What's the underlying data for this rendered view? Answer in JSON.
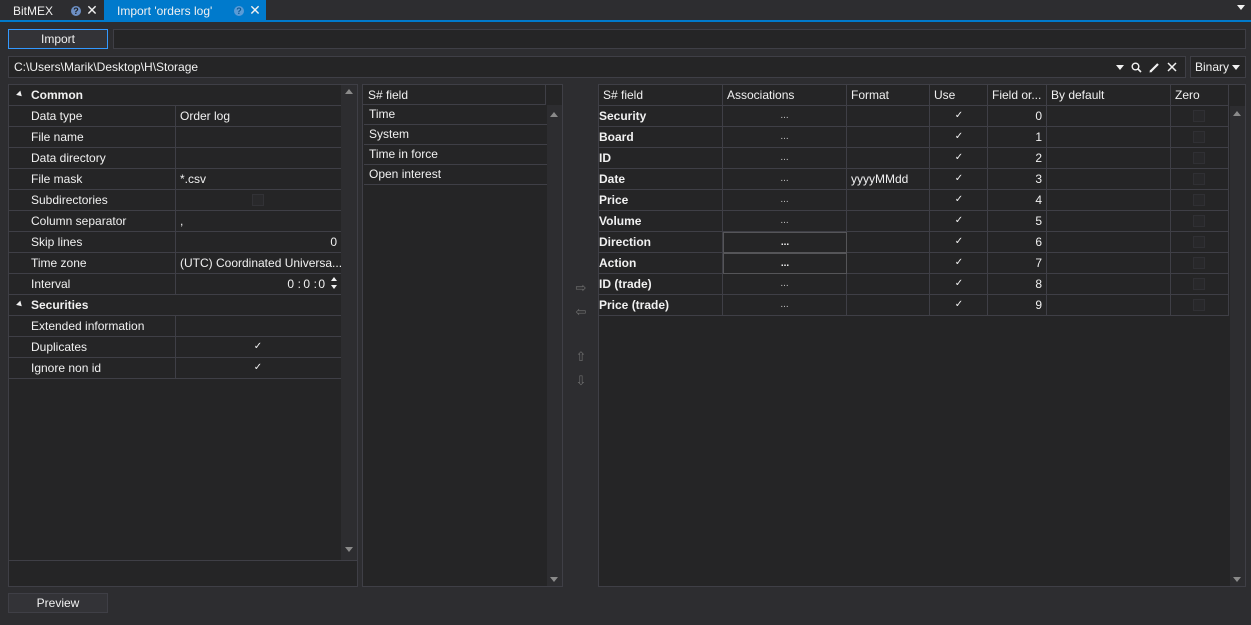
{
  "tabs": [
    {
      "label": "BitMEX"
    },
    {
      "label": "Import 'orders log'"
    }
  ],
  "toolbar": {
    "import_label": "Import",
    "preview_label": "Preview"
  },
  "storage": {
    "path": "C:\\Users\\Marik\\Desktop\\H\\Storage",
    "format": "Binary"
  },
  "properties": {
    "common": {
      "title": "Common",
      "data_type": {
        "name": "Data type",
        "value": "Order log"
      },
      "file_name": {
        "name": "File name",
        "value": ""
      },
      "data_directory": {
        "name": "Data directory",
        "value": ""
      },
      "file_mask": {
        "name": "File mask",
        "value": "*.csv"
      },
      "subdirectories": {
        "name": "Subdirectories",
        "checked": false
      },
      "column_separator": {
        "name": "Column separator",
        "value": ","
      },
      "skip_lines": {
        "name": "Skip lines",
        "value": "0"
      },
      "time_zone": {
        "name": "Time zone",
        "value": "(UTC) Coordinated Universa..."
      },
      "interval": {
        "name": "Interval",
        "h": "0",
        "m": "0",
        "s": "0"
      }
    },
    "securities": {
      "title": "Securities",
      "extended_information": {
        "name": "Extended information",
        "value": ""
      },
      "duplicates": {
        "name": "Duplicates",
        "checked": true
      },
      "ignore_non_id": {
        "name": "Ignore non id",
        "checked": true
      }
    }
  },
  "available_fields": {
    "header": "S# field",
    "items": [
      "Time",
      "System",
      "Time in force",
      "Open interest"
    ]
  },
  "mapping": {
    "columns": {
      "field": "S# field",
      "associations": "Associations",
      "format": "Format",
      "use": "Use",
      "order": "Field or...",
      "default": "By default",
      "zero": "Zero"
    },
    "rows": [
      {
        "field": "Security",
        "assoc": "...",
        "format": "",
        "use": true,
        "order": "0"
      },
      {
        "field": "Board",
        "assoc": "...",
        "format": "",
        "use": true,
        "order": "1"
      },
      {
        "field": "ID",
        "assoc": "...",
        "format": "",
        "use": true,
        "order": "2"
      },
      {
        "field": "Date",
        "assoc": "...",
        "format": "yyyyMMdd",
        "use": true,
        "order": "3"
      },
      {
        "field": "Price",
        "assoc": "...",
        "format": "",
        "use": true,
        "order": "4"
      },
      {
        "field": "Volume",
        "assoc": "...",
        "format": "",
        "use": true,
        "order": "5"
      },
      {
        "field": "Direction",
        "assoc": "...",
        "format": "",
        "use": true,
        "order": "6"
      },
      {
        "field": "Action",
        "assoc": "...",
        "format": "",
        "use": true,
        "order": "7"
      },
      {
        "field": "ID (trade)",
        "assoc": "...",
        "format": "",
        "use": true,
        "order": "8"
      },
      {
        "field": "Price (trade)",
        "assoc": "...",
        "format": "",
        "use": true,
        "order": "9"
      }
    ]
  },
  "colors": {
    "accent": "#007acc",
    "background": "#2d2d30",
    "panel": "#252526",
    "border": "#3f3f46"
  },
  "icons": {
    "dropdown": "chevron-down-icon",
    "search": "search-icon",
    "edit": "pencil-icon",
    "clear": "close-icon",
    "move_right": "arrow-right-icon",
    "move_left": "arrow-left-icon",
    "move_up": "arrow-up-icon",
    "move_down": "arrow-down-icon"
  }
}
